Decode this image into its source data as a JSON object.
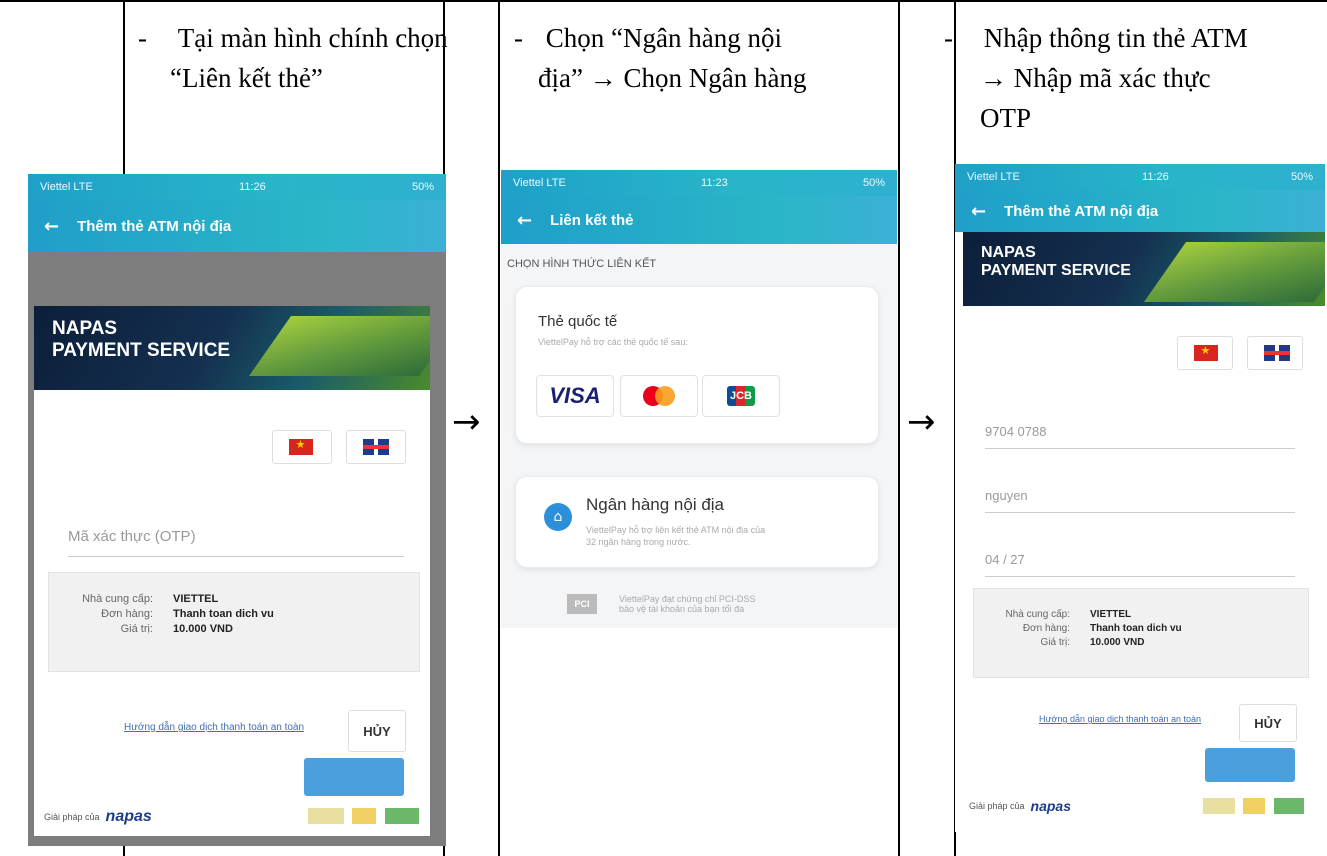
{
  "captions": [
    {
      "bullet": "-",
      "line1": "Tại màn hình chính chọn",
      "line2": "“Liên kết thẻ”"
    },
    {
      "bullet": "-",
      "line1": "Chọn “Ngân hàng nội",
      "line2": "địa” → Chọn Ngân hàng"
    },
    {
      "bullet": "-",
      "line1": "Nhập thông tin thẻ ATM",
      "line2": "→ Nhập mã xác thực",
      "line3": "OTP"
    }
  ],
  "arrows": [
    "→",
    "→"
  ],
  "status_bar": {
    "carrier": "Viettel LTE",
    "time1": "11:26",
    "time2": "11:23",
    "time3": "11:26",
    "battery": "50%"
  },
  "screen1": {
    "back": "←",
    "title": "Thêm thẻ ATM nội địa",
    "banner_line1": "NAPAS",
    "banner_line2": "PAYMENT SERVICE",
    "otp_placeholder": "Mã xác thực (OTP)",
    "info": [
      {
        "k": "Nhà cung cấp:",
        "v": "VIETTEL"
      },
      {
        "k": "Đơn hàng:",
        "v": "Thanh toan dich vu"
      },
      {
        "k": "Giá trị:",
        "v": "10.000 VND"
      }
    ],
    "guide": "Hướng dẫn giao dịch thanh toán an toàn",
    "cancel": "HỦY",
    "footer_prefix": "Giải pháp của",
    "footer_logo": "napas"
  },
  "screen2": {
    "back": "←",
    "title": "Liên kết thẻ",
    "section": "CHỌN HÌNH THỨC LIÊN KẾT",
    "intl_title": "Thẻ quốc tế",
    "intl_sub": "ViettelPay hỗ trợ các thẻ quốc tế sau:",
    "brands": [
      "VISA",
      "",
      "JCB"
    ],
    "domestic_title": "Ngân hàng nội địa",
    "domestic_sub1": "ViettelPay hỗ trợ liên kết thẻ ATM nội địa của",
    "domestic_sub2": "32 ngân hàng trong nước.",
    "pci_label": "PCI",
    "pci_text1": "ViettelPay đạt chứng chỉ PCI-DSS",
    "pci_text2": "bảo vệ tài khoản của bạn tối đa"
  },
  "screen3": {
    "back": "←",
    "title": "Thêm thẻ ATM nội địa",
    "banner_line1": "NAPAS",
    "banner_line2": "PAYMENT SERVICE",
    "card_number": "9704 0788",
    "card_name": "nguyen",
    "expiry": "04 / 27",
    "info": [
      {
        "k": "Nhà cung cấp:",
        "v": "VIETTEL"
      },
      {
        "k": "Đơn hàng:",
        "v": "Thanh toan dich vu"
      },
      {
        "k": "Giá trị:",
        "v": "10.000 VND"
      }
    ],
    "guide": "Hướng dẫn giao dịch thanh toán an toàn",
    "cancel": "HỦY",
    "footer_prefix": "Giải pháp của",
    "footer_logo": "napas"
  }
}
